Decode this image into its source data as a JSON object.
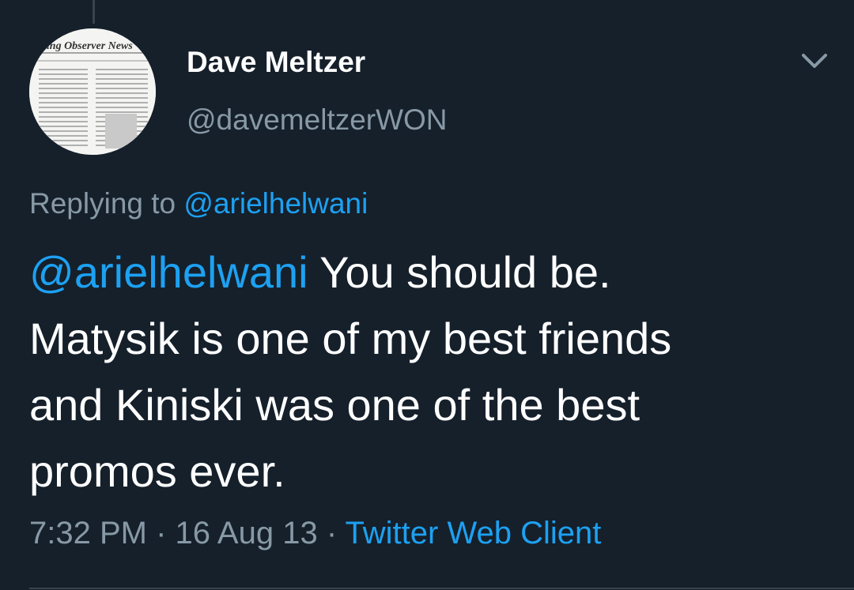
{
  "tweet": {
    "author": {
      "name": "Dave Meltzer",
      "handle": "@davemeltzerWON",
      "avatar_masthead": "ling Observer News"
    },
    "reply": {
      "prefix": "Replying to",
      "to": "@arielhelwani"
    },
    "body": {
      "mention": "@arielhelwani",
      "line1_rest": " You should be.",
      "line2": "Matysik is one of my best friends",
      "line3": "and Kiniski was one of the best",
      "line4": "promos ever."
    },
    "meta": {
      "time": "7:32 PM",
      "separator": " · ",
      "date": "16 Aug 13",
      "source": "Twitter Web Client"
    }
  },
  "icons": {
    "menu": "chevron-down-icon"
  },
  "colors": {
    "background": "#15202b",
    "text": "#ffffff",
    "secondary_text": "#8899a6",
    "accent": "#1da1f2",
    "divider": "#38444d"
  }
}
